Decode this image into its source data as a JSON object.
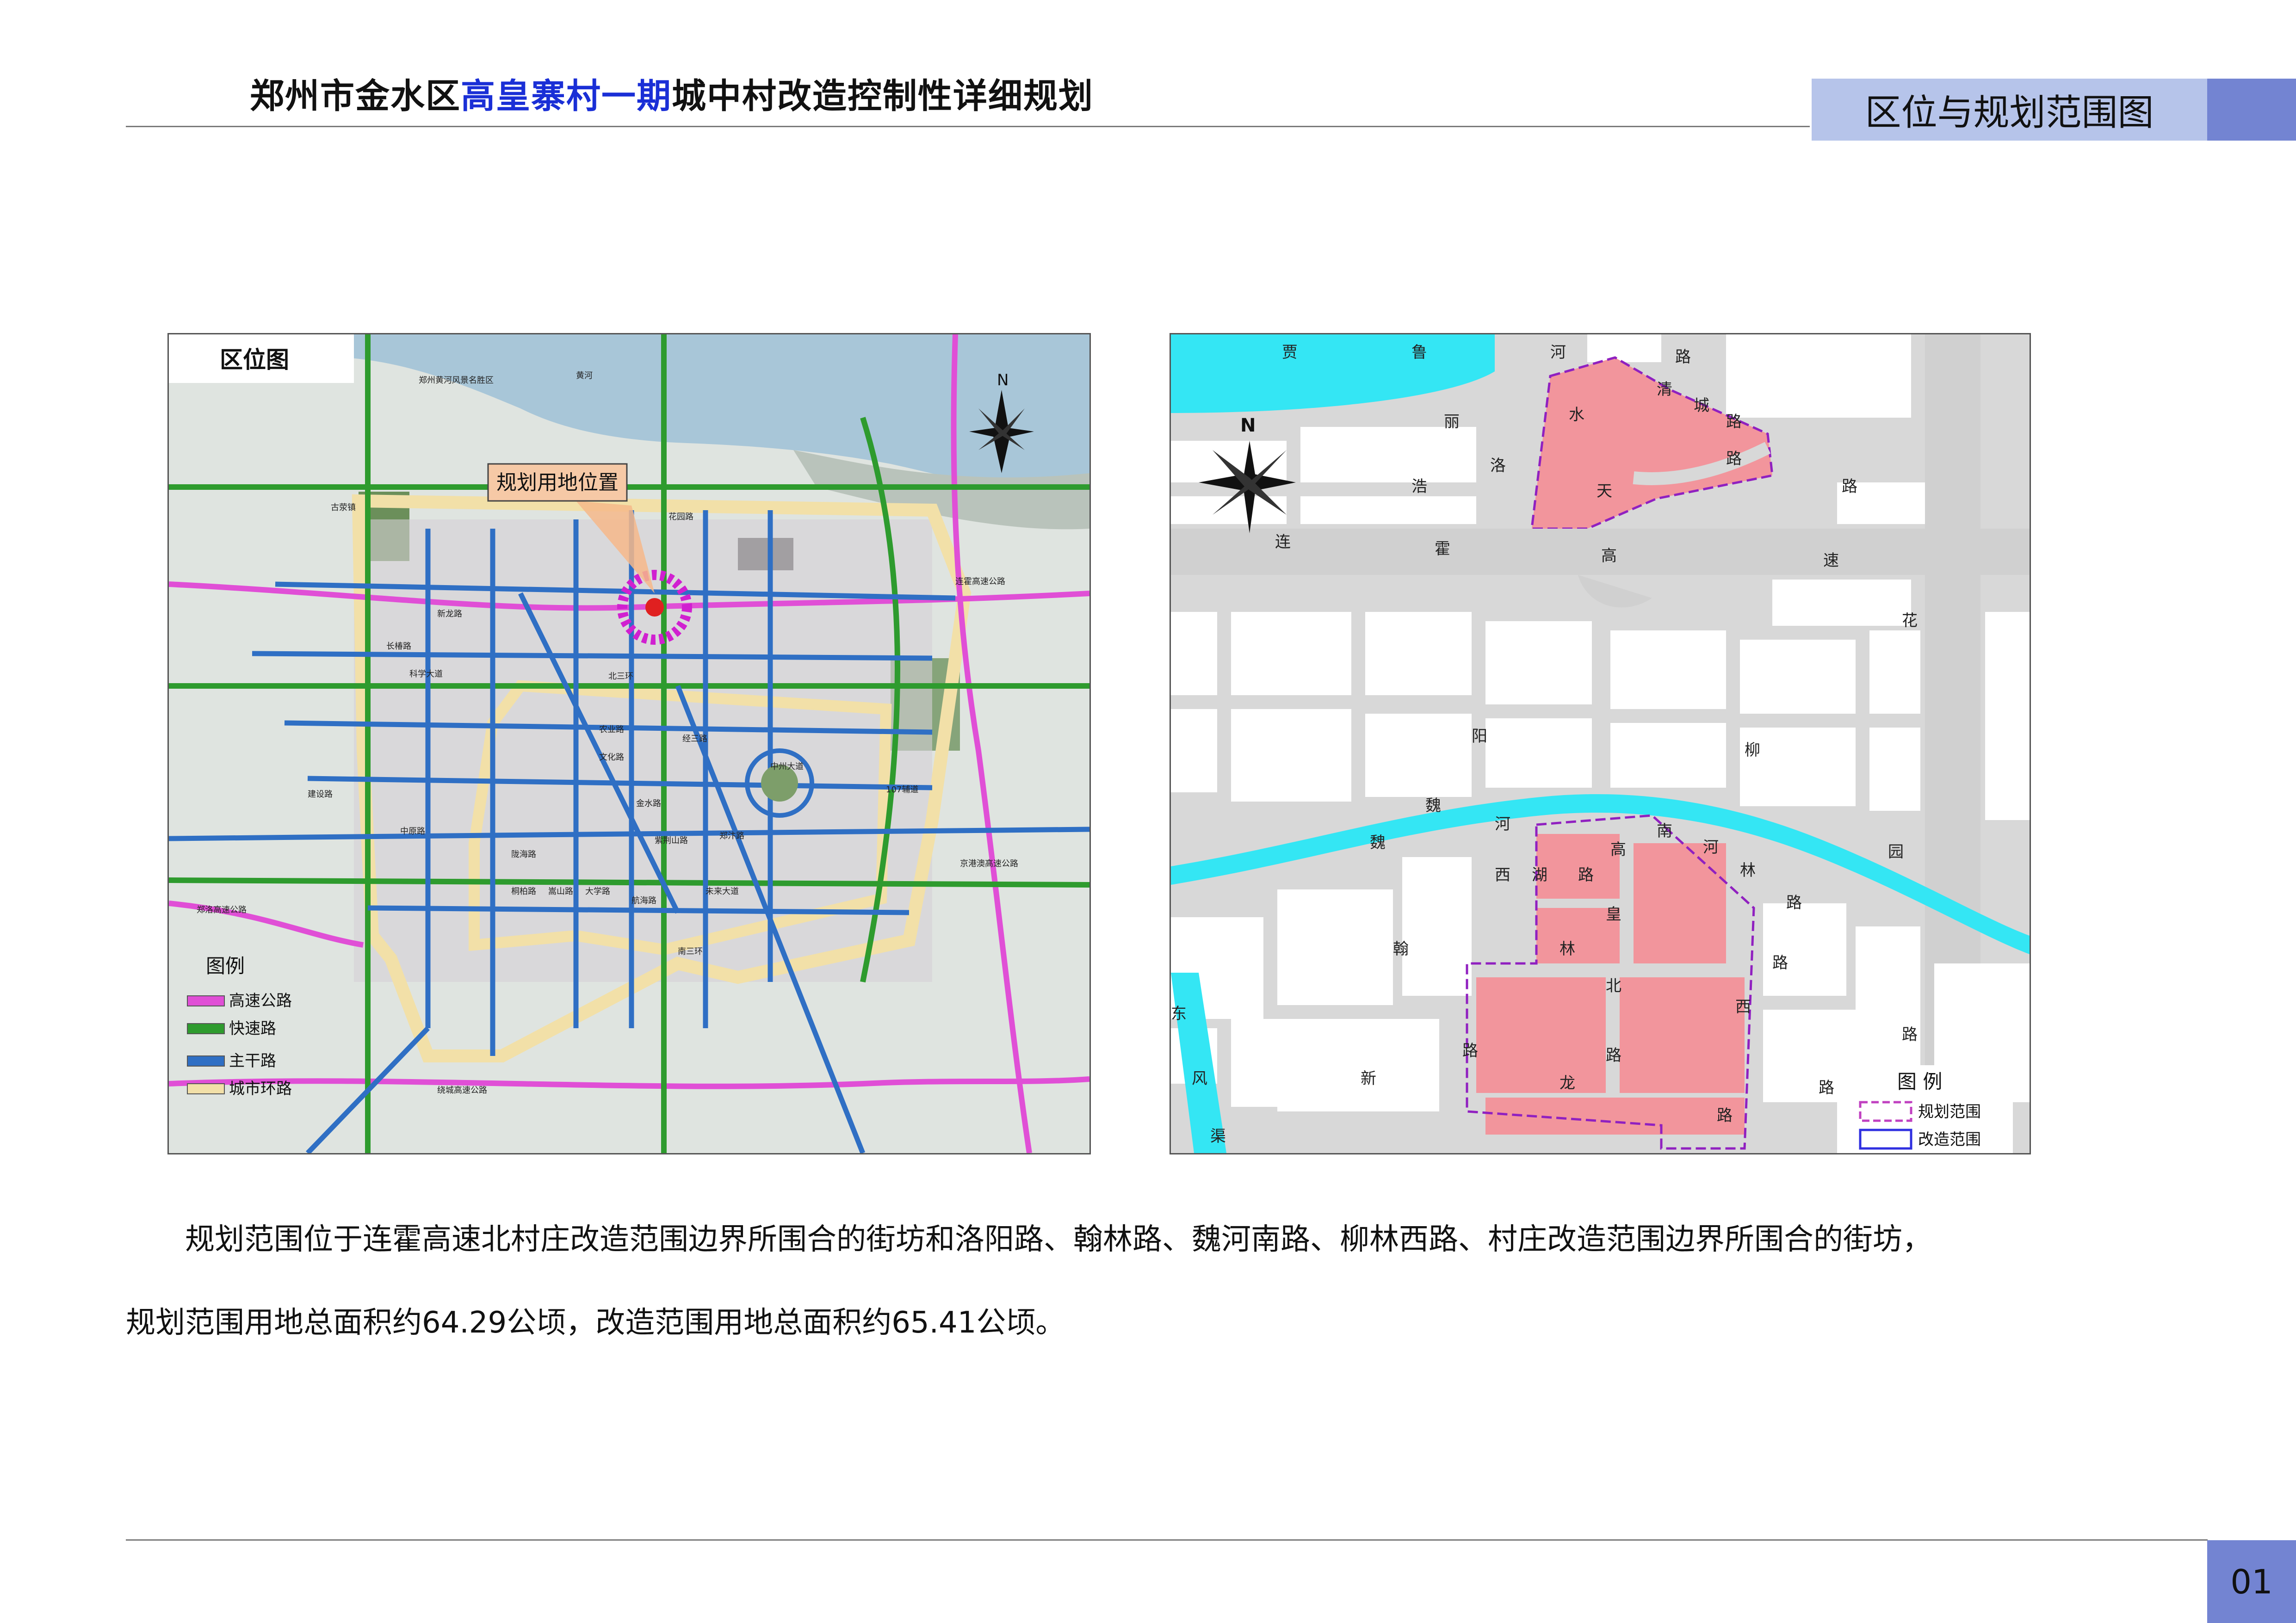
{
  "header": {
    "title_part1": "郑州市金水区",
    "title_highlight": "高皇寨村一期",
    "title_part2": "城中村改造控制性详细规划",
    "section_title": "区位与规划范围图"
  },
  "location_map": {
    "title": "区位图",
    "callout": "规划用地位置",
    "compass": "N",
    "legend": {
      "title": "图例",
      "items": [
        {
          "label": "高速公路",
          "color": "#e04fd6"
        },
        {
          "label": "快速路",
          "color": "#2e9b2e"
        },
        {
          "label": "主干路",
          "color": "#2f6fc4"
        },
        {
          "label": "城市环路",
          "color": "#f2e0a8"
        }
      ]
    },
    "labels": [
      "郑州黄河风景名胜区",
      "黄河",
      "古荥镇",
      "新龙路",
      "科学大道",
      "长椿路",
      "建设路",
      "中原路",
      "陇海路",
      "桐柏路",
      "嵩山路",
      "大学路",
      "航海路",
      "紫荆山路",
      "未来大道",
      "郑汴路",
      "107辅道",
      "京港澳高速公路",
      "郑洛高速公路",
      "连霍高速公路",
      "绕城高速公路",
      "北三环",
      "南三环",
      "中州大道",
      "农业路",
      "花园路",
      "文化路",
      "经三路",
      "金水路"
    ],
    "colors": {
      "water": "#a8c6d8",
      "land": "#dfe4e0",
      "green": "#7d9e6a"
    }
  },
  "site_map": {
    "compass": "N",
    "legend": {
      "title": "图 例",
      "items": [
        {
          "label": "规划范围",
          "color": "#c040c0"
        },
        {
          "label": "改造范围",
          "color": "#3030e0"
        }
      ]
    },
    "road_chars": [
      {
        "t": "贾"
      },
      {
        "t": "鲁"
      },
      {
        "t": "河"
      },
      {
        "t": "路"
      },
      {
        "t": "清"
      },
      {
        "t": "城"
      },
      {
        "t": "路"
      },
      {
        "t": "水"
      },
      {
        "t": "路"
      },
      {
        "t": "丽"
      },
      {
        "t": "洛"
      },
      {
        "t": "浩"
      },
      {
        "t": "天"
      },
      {
        "t": "路"
      },
      {
        "t": "连"
      },
      {
        "t": "霍"
      },
      {
        "t": "高"
      },
      {
        "t": "速"
      },
      {
        "t": "花"
      },
      {
        "t": "阳"
      },
      {
        "t": "柳"
      },
      {
        "t": "魏"
      },
      {
        "t": "魏"
      },
      {
        "t": "河"
      },
      {
        "t": "高"
      },
      {
        "t": "南"
      },
      {
        "t": "河"
      },
      {
        "t": "园"
      },
      {
        "t": "西"
      },
      {
        "t": "湖"
      },
      {
        "t": "路"
      },
      {
        "t": "林"
      },
      {
        "t": "路"
      },
      {
        "t": "皇"
      },
      {
        "t": "翰"
      },
      {
        "t": "林"
      },
      {
        "t": "路"
      },
      {
        "t": "北"
      },
      {
        "t": "西"
      },
      {
        "t": "路"
      },
      {
        "t": "东"
      },
      {
        "t": "路"
      },
      {
        "t": "路"
      },
      {
        "t": "新"
      },
      {
        "t": "龙"
      },
      {
        "t": "路"
      },
      {
        "t": "风"
      },
      {
        "t": "路"
      },
      {
        "t": "渠"
      }
    ],
    "colors": {
      "water": "#34e6f4",
      "plan_fill": "#f2959c",
      "road": "#d8d8d8",
      "block": "#ffffff"
    }
  },
  "description": {
    "line1": "规划范围位于连霍高速北村庄改造范围边界所围合的街坊和洛阳路、翰林路、魏河南路、柳林西路、村庄改造范围边界所围合的街坊，",
    "line2": "规划范围用地总面积约64.29公顷，改造范围用地总面积约65.41公顷。"
  },
  "footer": {
    "page_number": "01"
  }
}
